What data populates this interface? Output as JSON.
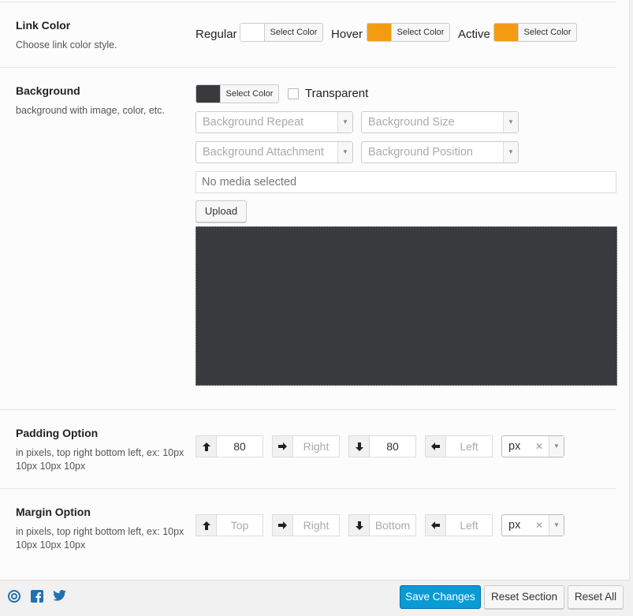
{
  "link_color": {
    "title": "Link Color",
    "description": "Choose link color style.",
    "pickers": [
      {
        "label": "Regular",
        "button": "Select Color",
        "color": "#ffffff"
      },
      {
        "label": "Hover",
        "button": "Select Color",
        "color": "#f39c12"
      },
      {
        "label": "Active",
        "button": "Select Color",
        "color": "#f39c12"
      }
    ]
  },
  "background": {
    "title": "Background",
    "description": "background with image, color, etc.",
    "color_button": "Select Color",
    "color": "#393a3e",
    "transparent_label": "Transparent",
    "repeat_placeholder": "Background Repeat",
    "size_placeholder": "Background Size",
    "attachment_placeholder": "Background Attachment",
    "position_placeholder": "Background Position",
    "media_placeholder": "No media selected",
    "upload_label": "Upload"
  },
  "padding": {
    "title": "Padding Option",
    "description": "in pixels, top right bottom left, ex: 10px 10px 10px 10px",
    "top": "80",
    "right": "Right",
    "bottom": "80",
    "left": "Left",
    "unit": "px"
  },
  "margin": {
    "title": "Margin Option",
    "description": "in pixels, top right bottom left, ex: 10px 10px 10px 10px",
    "top": "Top",
    "right": "Right",
    "bottom": "Bottom",
    "left": "Left",
    "unit": "px"
  },
  "footer": {
    "save": "Save Changes",
    "reset_section": "Reset Section",
    "reset_all": "Reset All",
    "icons": [
      "support-icon",
      "facebook-icon",
      "twitter-icon"
    ]
  }
}
